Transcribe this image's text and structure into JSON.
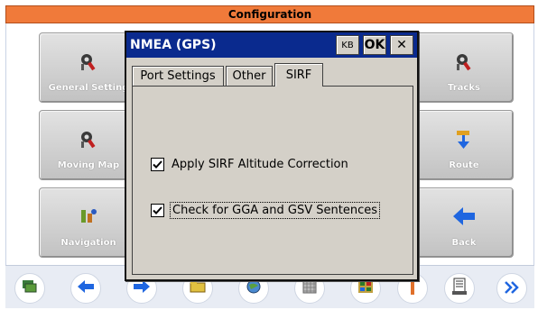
{
  "app": {
    "title": "Configuration",
    "tiles": [
      {
        "label": "General Setting",
        "icon": "gear-tools-icon"
      },
      {
        "label": "Moving Map",
        "icon": "gear-tools-icon"
      },
      {
        "label": "Navigation",
        "icon": "navigation-icon"
      },
      {
        "label": "Tracks",
        "icon": "gear-tools-icon"
      },
      {
        "label": "Route",
        "icon": "route-icon"
      },
      {
        "label": "Back",
        "icon": "back-arrow-icon"
      }
    ],
    "toolbar_icons": [
      "layers-icon",
      "back-icon",
      "forward-icon",
      "folder-icon",
      "globe-icon",
      "grid-icon",
      "table-icon",
      "bar-icon",
      "document-icon",
      "more-icon"
    ]
  },
  "dialog": {
    "title": "NMEA (GPS)",
    "kb_label": "KB",
    "ok_label": "OK",
    "close_label": "✕",
    "tabs": [
      {
        "label": "Port Settings",
        "active": false
      },
      {
        "label": "Other",
        "active": false
      },
      {
        "label": "SIRF",
        "active": true
      }
    ],
    "options": [
      {
        "label": "Apply SIRF Altitude Correction",
        "checked": true
      },
      {
        "label": "Check for GGA and GSV Sentences",
        "checked": true
      }
    ]
  },
  "colors": {
    "title_bar": "#f07a3a",
    "dialog_title": "#0a2a8e",
    "accent_blue": "#1f66e0"
  }
}
